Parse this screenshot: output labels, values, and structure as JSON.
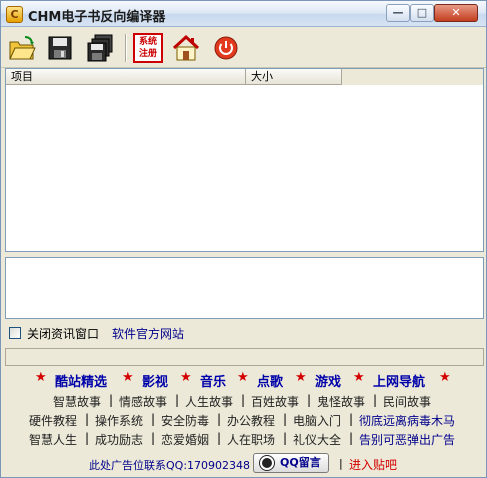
{
  "window": {
    "title": "CHM电子书反向编译器",
    "app_icon_glyph": "C",
    "controls": {
      "minimize": "—",
      "maximize": "□",
      "close": "✕"
    }
  },
  "toolbar": {
    "tools": [
      {
        "name": "open-folder-icon"
      },
      {
        "name": "save-icon"
      },
      {
        "name": "save-all-icon"
      },
      {
        "name": "system-register-stamp",
        "label": "系统\n注册"
      },
      {
        "name": "home-icon"
      },
      {
        "name": "power-icon"
      }
    ],
    "stamp_line1": "系统",
    "stamp_line2": "注册"
  },
  "list": {
    "columns": [
      "项目",
      "大小"
    ]
  },
  "options": {
    "close_info_label": "关闭资讯窗口",
    "close_info_checked": false,
    "official_site_link": "软件官方网站"
  },
  "ads": {
    "top_categories": [
      "酷站精选",
      "影视",
      "音乐",
      "点歌",
      "游戏",
      "上网导航"
    ],
    "row1": [
      "智慧故事",
      "情感故事",
      "人生故事",
      "百姓故事",
      "鬼怪故事",
      "民间故事"
    ],
    "row2": [
      "硬件教程",
      "操作系统",
      "安全防毒",
      "办公教程",
      "电脑入门",
      "彻底远离病毒木马"
    ],
    "row3": [
      "智慧人生",
      "成功励志",
      "恋爱婚姻",
      "人在职场",
      "礼仪大全",
      "告别可恶弹出广告"
    ],
    "contact_text": "此处广告位联系QQ:170902348",
    "qq_button_label": "QQ留言",
    "forum_link": "进入贴吧",
    "separator": "|"
  },
  "colors": {
    "link_blue": "#00008b",
    "star_red": "#d40000",
    "window_bg": "#ece9d8"
  }
}
